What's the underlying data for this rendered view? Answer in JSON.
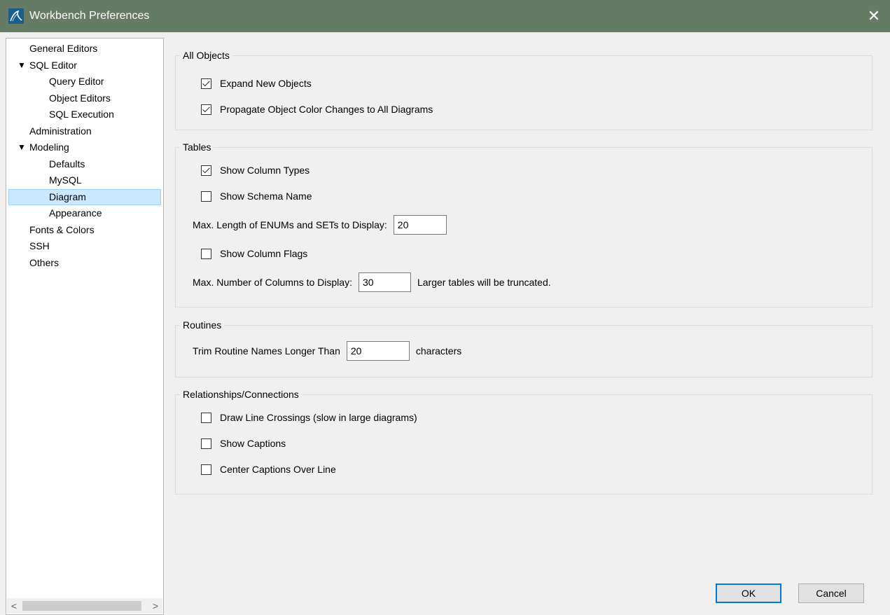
{
  "window": {
    "title": "Workbench Preferences",
    "close_glyph": "✕",
    "icon": "mysql-workbench-icon",
    "titlebar_color": "#667b66"
  },
  "sidebar": {
    "items": [
      {
        "label": "General Editors",
        "level": 0
      },
      {
        "label": "SQL Editor",
        "level": 0,
        "expanded": true
      },
      {
        "label": "Query Editor",
        "level": 1
      },
      {
        "label": "Object Editors",
        "level": 1
      },
      {
        "label": "SQL Execution",
        "level": 1
      },
      {
        "label": "Administration",
        "level": 0
      },
      {
        "label": "Modeling",
        "level": 0,
        "expanded": true
      },
      {
        "label": "Defaults",
        "level": 1
      },
      {
        "label": "MySQL",
        "level": 1
      },
      {
        "label": "Diagram",
        "level": 1,
        "selected": true
      },
      {
        "label": "Appearance",
        "level": 1
      },
      {
        "label": "Fonts & Colors",
        "level": 0
      },
      {
        "label": "SSH",
        "level": 0
      },
      {
        "label": "Others",
        "level": 0
      }
    ],
    "expand_glyph": "▼",
    "scroll_left": "<",
    "scroll_right": ">",
    "selected_color": "#cce8ff"
  },
  "all_objects": {
    "legend": "All Objects",
    "expand_new_objects": {
      "label": "Expand New Objects",
      "checked": true
    },
    "propagate_color": {
      "label": "Propagate Object Color Changes to All Diagrams",
      "checked": true
    }
  },
  "tables": {
    "legend": "Tables",
    "show_column_types": {
      "label": "Show Column Types",
      "checked": true
    },
    "show_schema_name": {
      "label": "Show Schema Name",
      "checked": false
    },
    "max_enum_label": "Max. Length of ENUMs and SETs to Display:",
    "max_enum_value": "20",
    "show_column_flags": {
      "label": "Show Column Flags",
      "checked": false
    },
    "max_columns_label": "Max. Number of Columns to Display:",
    "max_columns_value": "30",
    "max_columns_note": "Larger tables will be truncated."
  },
  "routines": {
    "legend": "Routines",
    "trim_label": "Trim Routine Names Longer Than",
    "trim_value": "20",
    "trim_unit": "characters"
  },
  "relationships": {
    "legend": "Relationships/Connections",
    "draw_crossings": {
      "label": "Draw Line Crossings (slow in large diagrams)",
      "checked": false
    },
    "show_captions": {
      "label": "Show Captions",
      "checked": false
    },
    "center_captions": {
      "label": "Center Captions Over Line",
      "checked": false
    }
  },
  "footer": {
    "ok_label": "OK",
    "cancel_label": "Cancel",
    "accent": "#0078d7"
  }
}
